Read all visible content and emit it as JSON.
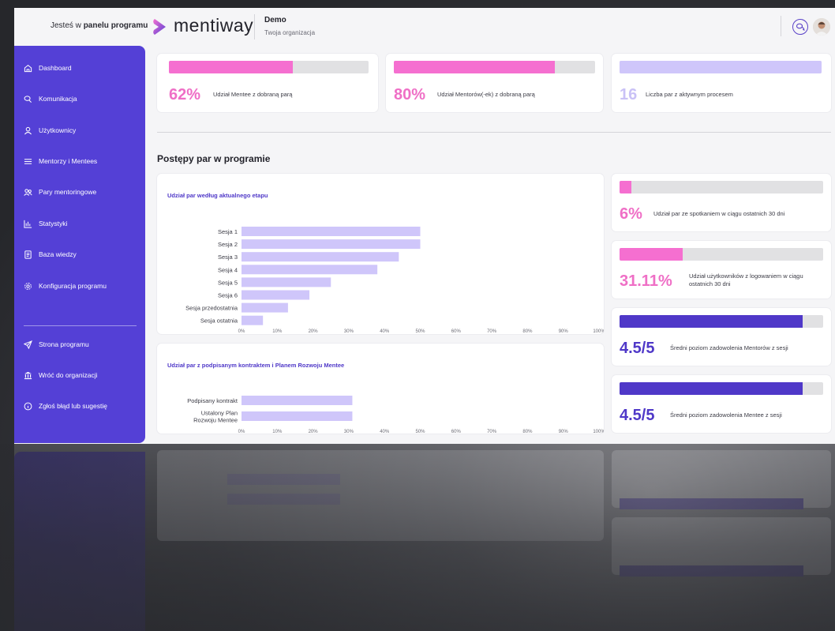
{
  "header": {
    "you_are_prefix": "Jesteś w",
    "you_are_bold": "panelu programu",
    "logo_text": "mentiway",
    "org_name": "Demo",
    "org_sub": "Twoja organizacja",
    "chat_icon": "chat-bubbles-icon",
    "avatar_icon": "user-avatar"
  },
  "sidebar": {
    "items": [
      {
        "label": "Dashboard",
        "icon": "home-icon"
      },
      {
        "label": "Komunikacja",
        "icon": "chat-icon"
      },
      {
        "label": "Użytkownicy",
        "icon": "user-icon"
      },
      {
        "label": "Mentorzy i Mentees",
        "icon": "list-icon"
      },
      {
        "label": "Pary mentoringowe",
        "icon": "users-icon"
      },
      {
        "label": "Statystyki",
        "icon": "bar-chart-icon"
      },
      {
        "label": "Baza wiedzy",
        "icon": "book-icon"
      },
      {
        "label": "Konfiguracja programu",
        "icon": "gear-icon"
      }
    ],
    "bottom_items": [
      {
        "label": "Strona programu",
        "icon": "send-icon"
      },
      {
        "label": "Wróć do organizacji",
        "icon": "bank-icon"
      },
      {
        "label": "Zgłoś błąd lub sugestię",
        "icon": "info-icon"
      }
    ]
  },
  "top_stats": [
    {
      "value": "62%",
      "fill": 0.62,
      "label": "Udział Mentee z dobraną parą",
      "color": "#f56fd0"
    },
    {
      "value": "80%",
      "fill": 0.8,
      "label": "Udział Mentorów(-ek) z dobraną parą",
      "color": "#f56fd0"
    },
    {
      "value": "16",
      "fill": 1.0,
      "label": "Liczba par z aktywnym procesem",
      "color": "#cfc6fa"
    }
  ],
  "section_title": "Postępy par w programie",
  "chart_data": [
    {
      "type": "bar",
      "orientation": "horizontal",
      "title": "Udział par według aktualnego etapu",
      "categories": [
        "Sesja 1",
        "Sesja 2",
        "Sesja 3",
        "Sesja 4",
        "Sesja 5",
        "Sesja 6",
        "Sesja przedostatnia",
        "Sesja ostatnia"
      ],
      "values": [
        50,
        50,
        44,
        38,
        25,
        19,
        13,
        6
      ],
      "xlim": [
        0,
        100
      ],
      "ticks": [
        "0%",
        "10%",
        "20%",
        "30%",
        "40%",
        "50%",
        "60%",
        "70%",
        "80%",
        "90%",
        "100%"
      ],
      "color": "#cfc6fa"
    },
    {
      "type": "bar",
      "orientation": "horizontal",
      "title": "Udział par z podpisanym kontraktem i Planem Rozwoju Mentee",
      "categories": [
        [
          "Podpisany kontrakt"
        ],
        [
          "Ustalony Plan",
          "Rozwoju Mentee"
        ]
      ],
      "values": [
        31,
        31
      ],
      "xlim": [
        0,
        100
      ],
      "ticks": [
        "0%",
        "10%",
        "20%",
        "30%",
        "40%",
        "50%",
        "60%",
        "70%",
        "80%",
        "90%",
        "100%"
      ],
      "color": "#cfc6fa"
    }
  ],
  "side_stats": [
    {
      "value": "6%",
      "fill": 0.06,
      "label": [
        "Udział par ze spotkaniem w ciągu ostatnich 30 dni"
      ],
      "color": "#f56fd0",
      "text_color": "#ef6fc6"
    },
    {
      "value": "31.11%",
      "fill": 0.3111,
      "label": [
        "Udział użytkowników z logowaniem w ciągu",
        "ostatnich 30 dni"
      ],
      "color": "#f56fd0",
      "text_color": "#ef6fc6"
    },
    {
      "value": "4.5/5",
      "fill": 0.9,
      "label": [
        "Średni poziom zadowolenia Mentorów z sesji"
      ],
      "color": "#4f38c8",
      "text_color": "#4f38c8"
    },
    {
      "value": "4.5/5",
      "fill": 0.9,
      "label": [
        "Średni poziom zadowolenia Mentee z sesji"
      ],
      "color": "#4f38c8",
      "text_color": "#4f38c8"
    }
  ]
}
